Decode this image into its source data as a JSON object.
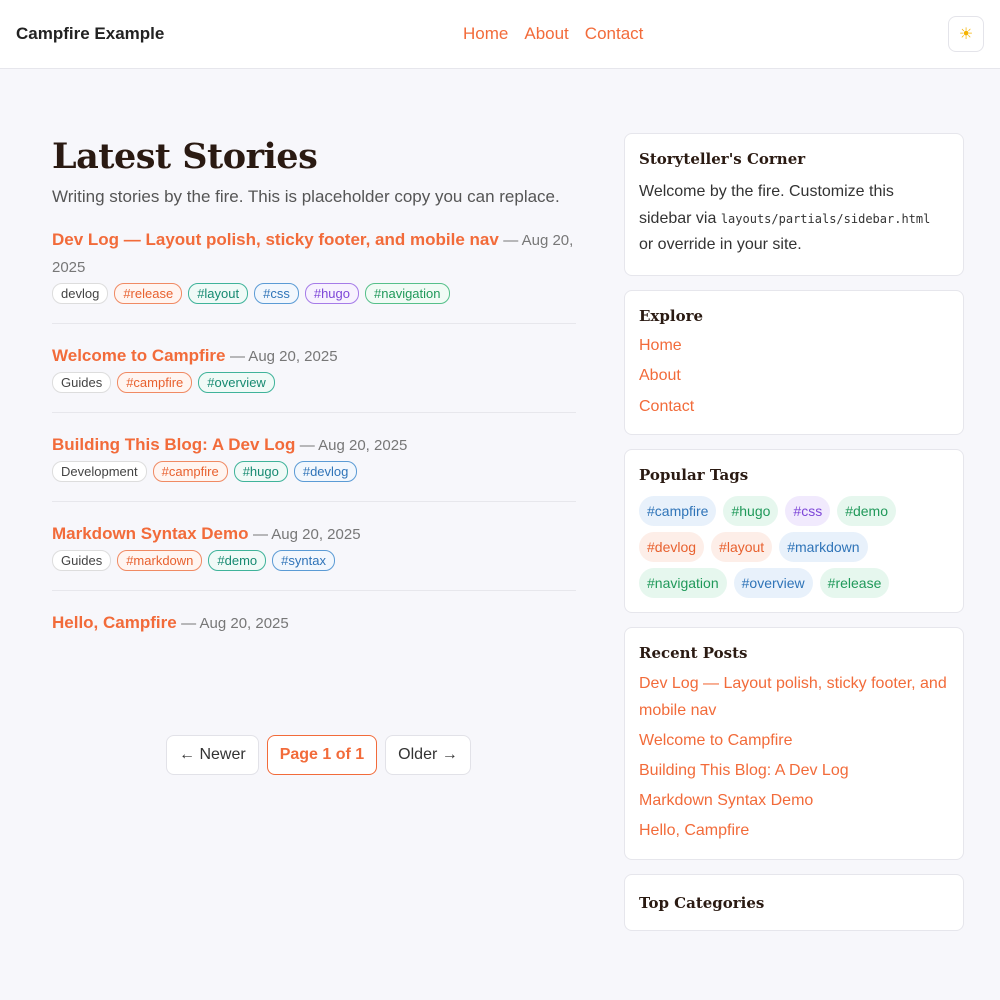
{
  "header": {
    "brand": "Campfire Example",
    "nav": [
      "Home",
      "About",
      "Contact"
    ],
    "theme_icon": "sun-icon"
  },
  "main": {
    "title": "Latest Stories",
    "description": "Writing stories by the fire. This is placeholder copy you can replace.",
    "posts": [
      {
        "title": "Dev Log — Layout polish, sticky footer, and mobile nav",
        "date": "— Aug 20, 2025",
        "category": "devlog",
        "tags": [
          "#release",
          "#layout",
          "#css",
          "#hugo",
          "#navigation"
        ]
      },
      {
        "title": "Welcome to Campfire",
        "date": "— Aug 20, 2025",
        "category": "Guides",
        "tags": [
          "#campfire",
          "#overview"
        ]
      },
      {
        "title": "Building This Blog: A Dev Log",
        "date": "— Aug 20, 2025",
        "category": "Development",
        "tags": [
          "#campfire",
          "#hugo",
          "#devlog"
        ]
      },
      {
        "title": "Markdown Syntax Demo",
        "date": "— Aug 20, 2025",
        "category": "Guides",
        "tags": [
          "#markdown",
          "#demo",
          "#syntax"
        ]
      },
      {
        "title": "Hello, Campfire",
        "date": "— Aug 20, 2025"
      }
    ],
    "pager": {
      "newer": "← Newer",
      "current": "Page 1 of 1",
      "older": "Older →"
    }
  },
  "sidebar": {
    "corner": {
      "title": "Storyteller's Corner",
      "text_before": "Welcome by the fire. Customize this sidebar via",
      "code": "layouts/partials/sidebar.html",
      "text_after": "or override in your site."
    },
    "explore": {
      "title": "Explore",
      "links": [
        "Home",
        "About",
        "Contact"
      ]
    },
    "popular_tags": {
      "title": "Popular Tags",
      "tags": [
        "#campfire",
        "#hugo",
        "#css",
        "#demo",
        "#devlog",
        "#layout",
        "#markdown",
        "#navigation",
        "#overview",
        "#release"
      ]
    },
    "recent_posts": {
      "title": "Recent Posts",
      "links": [
        "Dev Log — Layout polish, sticky footer, and mobile nav",
        "Welcome to Campfire",
        "Building This Blog: A Dev Log",
        "Markdown Syntax Demo",
        "Hello, Campfire"
      ]
    },
    "top_categories": {
      "title": "Top Categories"
    }
  },
  "colors": {
    "accent": "#f26b3a",
    "background": "#f7f7fb",
    "heading": "#2a1a12"
  }
}
